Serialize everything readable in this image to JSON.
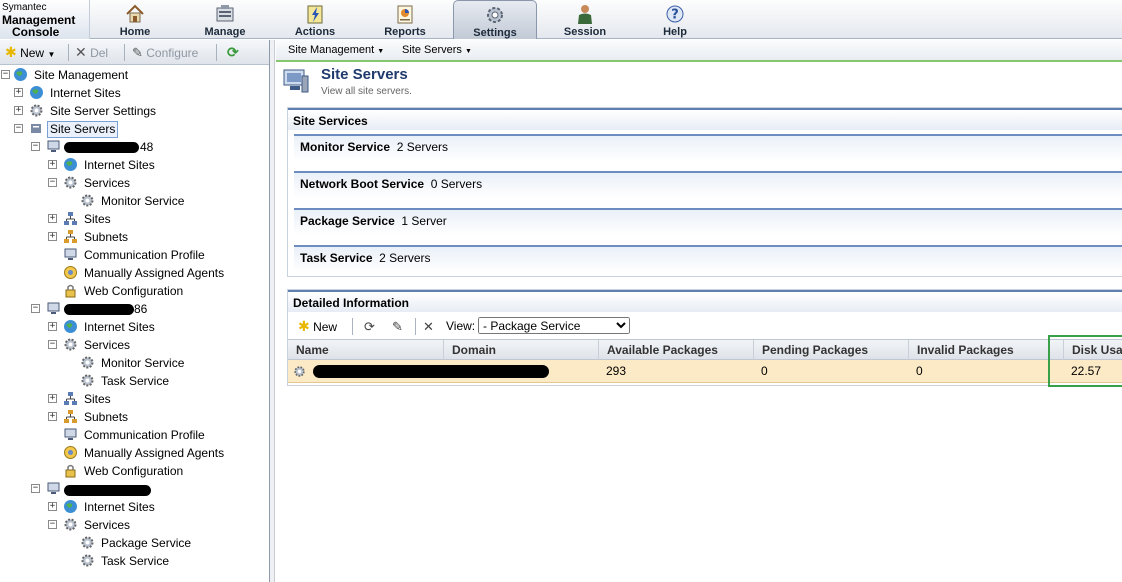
{
  "brand": {
    "line1": "Symantec",
    "line2": "Management",
    "line3": "Console"
  },
  "nav": [
    {
      "label": "Home",
      "icon": "home-icon"
    },
    {
      "label": "Manage",
      "icon": "manage-icon"
    },
    {
      "label": "Actions",
      "icon": "actions-icon"
    },
    {
      "label": "Reports",
      "icon": "reports-icon"
    },
    {
      "label": "Settings",
      "icon": "settings-icon",
      "active": true
    },
    {
      "label": "Session",
      "icon": "session-icon"
    },
    {
      "label": "Help",
      "icon": "help-icon"
    }
  ],
  "left_toolbar": {
    "new": "New",
    "del": "Del",
    "configure": "Configure"
  },
  "tree": {
    "root": "Site Management",
    "internet_sites": "Internet Sites",
    "site_server_settings": "Site Server Settings",
    "site_servers": "Site Servers",
    "server1_suffix": "48",
    "server2_suffix": "86",
    "internet_sites_label": "Internet Sites",
    "services": "Services",
    "monitor_service": "Monitor Service",
    "task_service": "Task Service",
    "package_service": "Package Service",
    "sites": "Sites",
    "subnets": "Subnets",
    "communication_profile": "Communication Profile",
    "manually_assigned_agents": "Manually Assigned Agents",
    "web_configuration": "Web Configuration"
  },
  "breadcrumb": {
    "item1": "Site Management",
    "item2": "Site Servers"
  },
  "header": {
    "title": "Site Servers",
    "subtitle": "View all site servers."
  },
  "site_services": {
    "heading": "Site Services",
    "rows": [
      {
        "name": "Monitor Service",
        "count": "2 Servers"
      },
      {
        "name": "Network Boot Service",
        "count": "0 Servers"
      },
      {
        "name": "Package Service",
        "count": "1 Server"
      },
      {
        "name": "Task Service",
        "count": "2 Servers"
      }
    ]
  },
  "detailed": {
    "heading": "Detailed Information",
    "new_label": "New",
    "view_label": "View:",
    "view_selected": "- Package Service",
    "columns": [
      "Name",
      "Domain",
      "Available Packages",
      "Pending Packages",
      "Invalid Packages",
      "Disk Usa"
    ],
    "row": {
      "available": "293",
      "pending": "0",
      "invalid": "0",
      "disk": "22.57"
    }
  },
  "colors": {
    "accent_green": "#39a04a",
    "row_highlight": "#fce9c6",
    "title_blue": "#1f3a6d"
  }
}
